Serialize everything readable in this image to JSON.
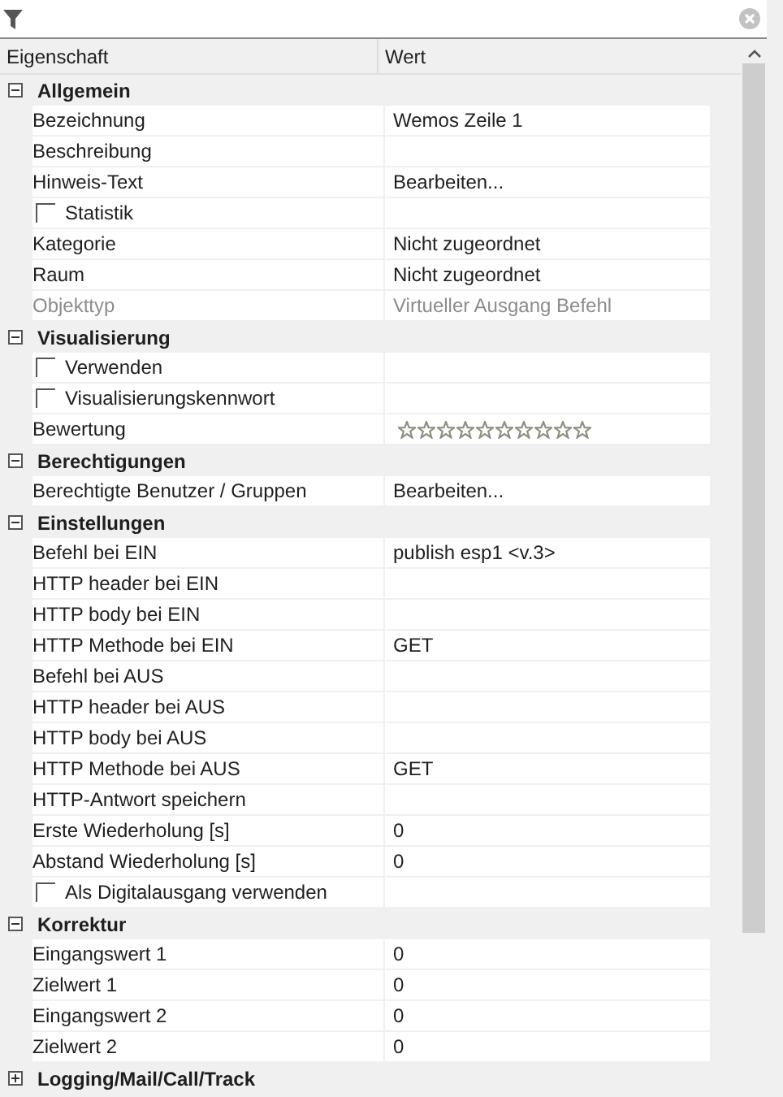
{
  "columns": [
    "Eigenschaft",
    "Wert"
  ],
  "sections": [
    {
      "title": "Allgemein",
      "expanded": true,
      "rows": [
        {
          "kind": "text",
          "label": "Bezeichnung",
          "value": "Wemos Zeile 1",
          "disabled": false
        },
        {
          "kind": "text",
          "label": "Beschreibung",
          "disabled": false
        },
        {
          "kind": "text",
          "label": "Hinweis-Text",
          "value": "Bearbeiten...",
          "disabled": false
        },
        {
          "kind": "checkbox",
          "label": "Statistik",
          "checked": false
        },
        {
          "kind": "text",
          "label": "Kategorie",
          "value": "Nicht zugeordnet",
          "disabled": false
        },
        {
          "kind": "text",
          "label": "Raum",
          "value": "Nicht zugeordnet",
          "disabled": false
        },
        {
          "kind": "text",
          "label": "Objekttyp",
          "value": "Virtueller Ausgang Befehl",
          "disabled": true
        }
      ]
    },
    {
      "title": "Visualisierung",
      "expanded": true,
      "rows": [
        {
          "kind": "checkbox",
          "label": "Verwenden",
          "checked": false
        },
        {
          "kind": "checkbox",
          "label": "Visualisierungskennwort",
          "checked": false
        },
        {
          "kind": "stars",
          "label": "Bewertung",
          "stars": 0
        }
      ]
    },
    {
      "title": "Berechtigungen",
      "expanded": true,
      "rows": [
        {
          "kind": "text",
          "label": "Berechtigte Benutzer / Gruppen",
          "value": "Bearbeiten...",
          "disabled": false
        }
      ]
    },
    {
      "title": "Einstellungen",
      "expanded": true,
      "rows": [
        {
          "kind": "text",
          "label": "Befehl bei EIN",
          "value": "publish esp1 <v.3>",
          "disabled": false
        },
        {
          "kind": "text",
          "label": "HTTP header bei EIN",
          "disabled": false
        },
        {
          "kind": "text",
          "label": "HTTP body bei EIN",
          "disabled": false
        },
        {
          "kind": "text",
          "label": "HTTP Methode bei EIN",
          "value": "GET",
          "disabled": false
        },
        {
          "kind": "text",
          "label": "Befehl bei AUS",
          "disabled": false
        },
        {
          "kind": "text",
          "label": "HTTP header bei AUS",
          "disabled": false
        },
        {
          "kind": "text",
          "label": "HTTP body bei AUS",
          "disabled": false
        },
        {
          "kind": "text",
          "label": "HTTP Methode bei AUS",
          "value": "GET",
          "disabled": false
        },
        {
          "kind": "text",
          "label": "HTTP-Antwort speichern",
          "disabled": false
        },
        {
          "kind": "text",
          "label": "Erste Wiederholung [s]",
          "value": "0",
          "disabled": false
        },
        {
          "kind": "text",
          "label": "Abstand Wiederholung [s]",
          "value": "0",
          "disabled": false
        },
        {
          "kind": "checkbox",
          "label": "Als Digitalausgang verwenden",
          "checked": false
        }
      ]
    },
    {
      "title": "Korrektur",
      "expanded": true,
      "rows": [
        {
          "kind": "text",
          "label": "Eingangswert 1",
          "value": "0",
          "disabled": false
        },
        {
          "kind": "text",
          "label": "Zielwert 1",
          "value": "0",
          "disabled": false
        },
        {
          "kind": "text",
          "label": "Eingangswert 2",
          "value": "0",
          "disabled": false
        },
        {
          "kind": "text",
          "label": "Zielwert 2",
          "value": "0",
          "disabled": false
        }
      ]
    },
    {
      "title": "Logging/Mail/Call/Track",
      "expanded": false
    }
  ]
}
